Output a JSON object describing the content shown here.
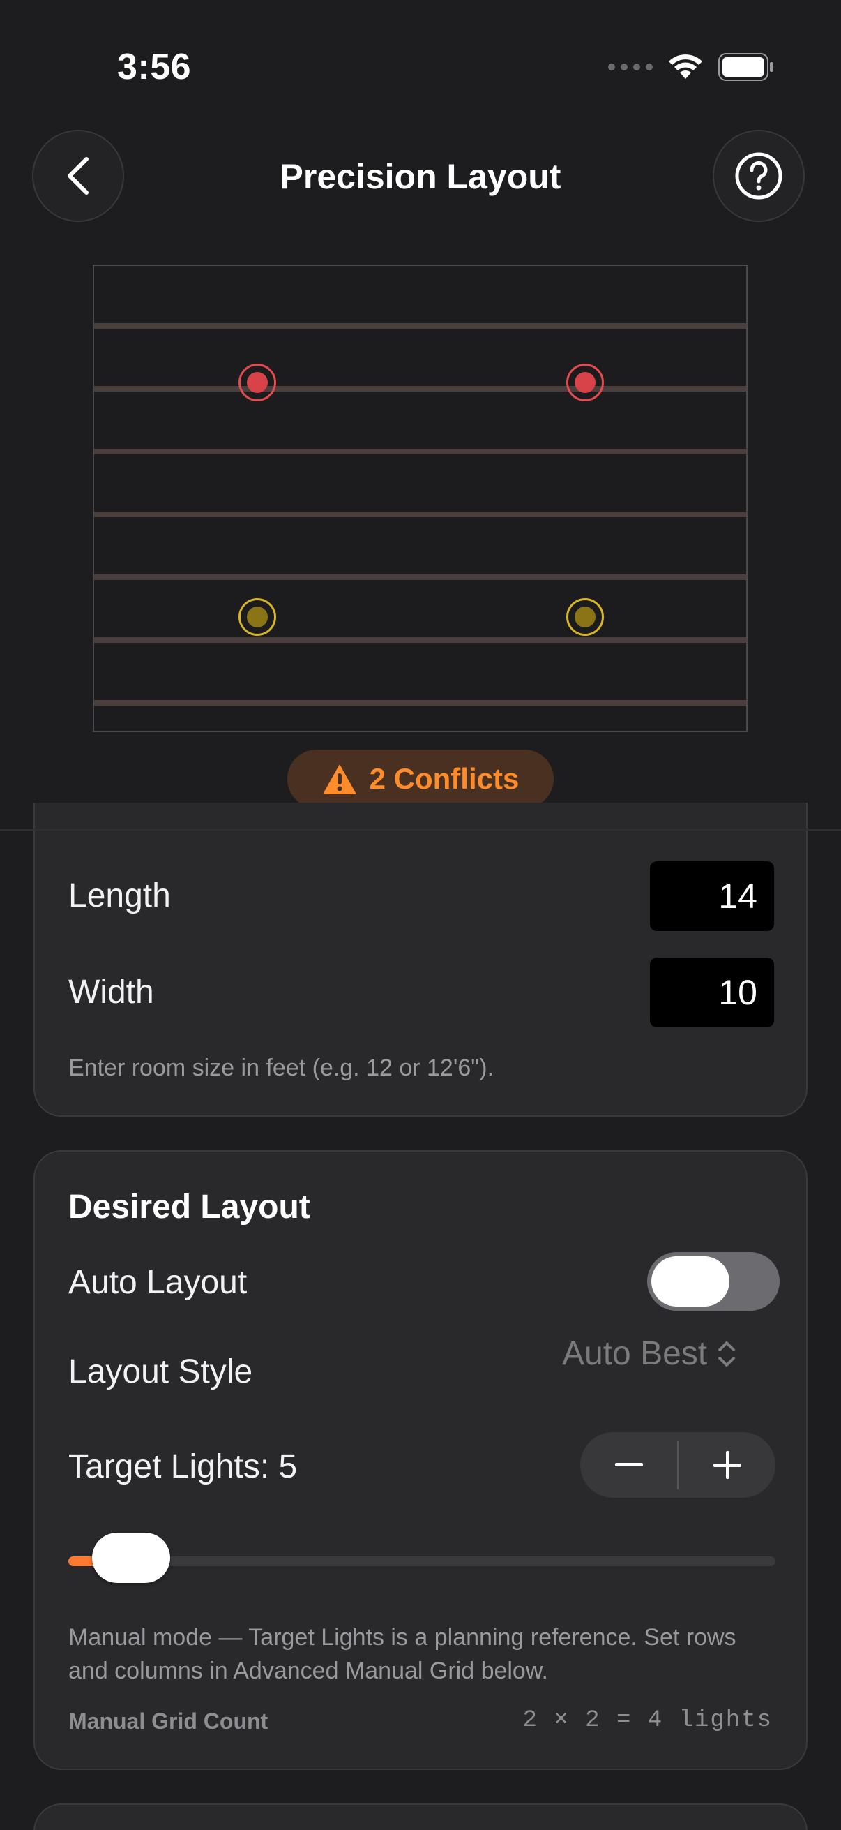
{
  "status": {
    "time": "3:56"
  },
  "header": {
    "title": "Precision Layout"
  },
  "plan": {
    "joist_count": 7,
    "conflict_lights": [
      {
        "color": "red",
        "row": 1,
        "col": 1
      },
      {
        "color": "red",
        "row": 1,
        "col": 2
      }
    ],
    "ok_lights": [
      {
        "color": "yellow",
        "row": 2,
        "col": 1
      },
      {
        "color": "yellow",
        "row": 2,
        "col": 2
      }
    ],
    "colors": {
      "conflict": "#e54a4c",
      "ok": "#d8b722",
      "joist": "#4a3f3c"
    }
  },
  "conflicts": {
    "label": "2 Conflicts",
    "icon": "warning-triangle-icon",
    "color": "#ff8c2b"
  },
  "room": {
    "length_label": "Length",
    "length_value": "14",
    "width_label": "Width",
    "width_value": "10",
    "hint": "Enter room size in feet (e.g. 12 or 12'6\")."
  },
  "layout": {
    "title": "Desired Layout",
    "auto_label": "Auto Layout",
    "auto_enabled": false,
    "style_label": "Layout Style",
    "style_value": "Auto Best",
    "target_label": "Target Lights: 5",
    "target_value": 5,
    "slider_fraction": 0.04,
    "hint": "Manual mode — Target Lights is a planning reference. Set rows and columns in Advanced Manual Grid below.",
    "count_label": "Manual Grid Count",
    "count_value": "2 × 2 = 4 lights"
  },
  "accent": "#ff7a30"
}
